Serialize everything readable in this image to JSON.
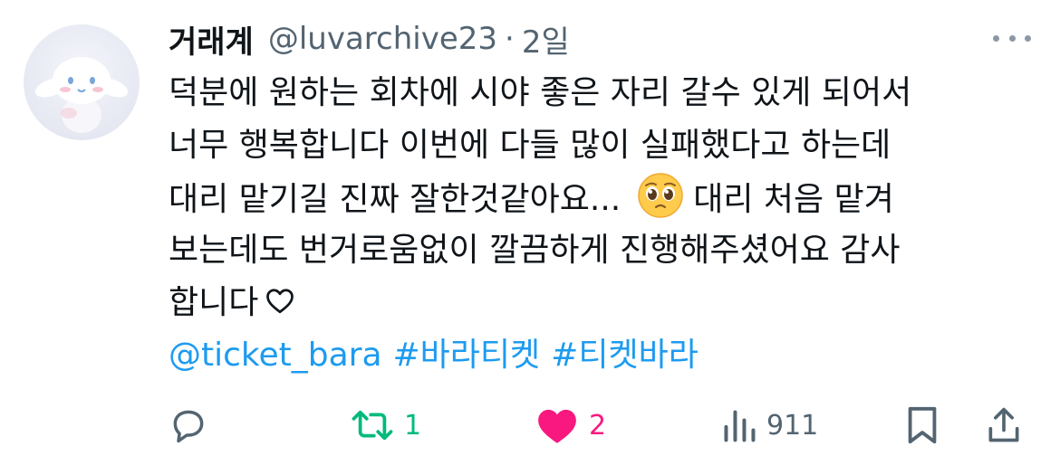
{
  "tweet": {
    "display_name": "거래계",
    "handle": "@luvarchive23",
    "separator": "·",
    "time": "2일",
    "text_lines": [
      "덕분에 원하는 회차에 시야 좋은 자리 갈수 있게 되어서",
      "너무 행복합니다 이번에 다들 많이 실패했다고 하는데",
      "대리 맡기길 진짜 잘한것같아요...",
      "대리 처음 맡겨",
      "보는데도 번거로움없이 깔끔하게 진행해주셨어요 감사",
      "합니다"
    ],
    "emoji": "pleading-face",
    "tags": [
      "@ticket_bara",
      "#바라티켓",
      "#티켓바라"
    ]
  },
  "actions": {
    "reply_count": "",
    "repost_count": "1",
    "like_count": "2",
    "views_count": "911"
  },
  "colors": {
    "text": "#0f1419",
    "secondary": "#536471",
    "link": "#1d9bf0",
    "repost_green": "#00ba7c",
    "like_pink": "#f91880"
  },
  "icons": [
    "reply-icon",
    "repost-icon",
    "like-icon",
    "views-icon",
    "bookmark-icon",
    "share-icon",
    "more-icon",
    "heart-outline-icon"
  ]
}
